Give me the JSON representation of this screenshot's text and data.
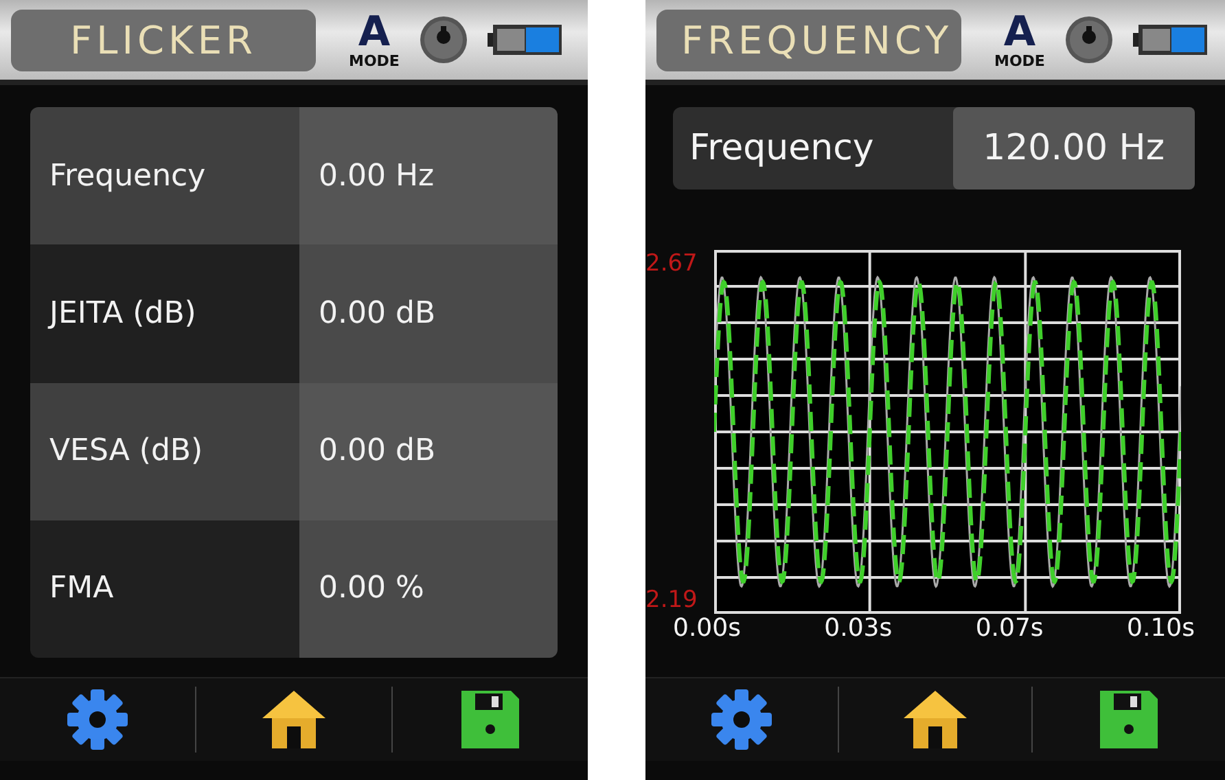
{
  "screens": [
    {
      "kind": "table",
      "title": "FLICKER",
      "mode_letter": "A",
      "mode_label": "MODE",
      "rows": [
        {
          "label": "Frequency",
          "value": "0.00 Hz"
        },
        {
          "label": "JEITA (dB)",
          "value": "0.00 dB"
        },
        {
          "label": "VESA (dB)",
          "value": "0.00 dB"
        },
        {
          "label": "FMA",
          "value": "0.00 %"
        }
      ]
    },
    {
      "kind": "waveform",
      "title": "FREQUENCY",
      "mode_letter": "A",
      "mode_label": "MODE",
      "reading": {
        "label": "Frequency",
        "value": "120.00 Hz"
      },
      "y_max": "2.67",
      "y_min": "2.19",
      "x_labels": [
        "0.00s",
        "0.03s",
        "0.07s",
        "0.10s"
      ]
    }
  ]
}
